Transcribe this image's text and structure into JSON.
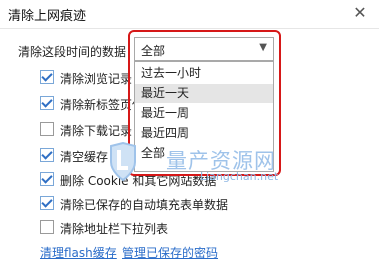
{
  "window": {
    "title": "清除上网痕迹",
    "close_glyph": "✕"
  },
  "range": {
    "label": "清除这段时间的数据：",
    "selected": "全部",
    "arrow_glyph": "▼",
    "options": [
      "过去一小时",
      "最近一天",
      "最近一周",
      "最近四周",
      "全部"
    ],
    "highlighted_index": 1
  },
  "items": [
    {
      "label": "清除浏览记录",
      "checked": true
    },
    {
      "label": "清除新标签页使",
      "checked": true
    },
    {
      "label": "清除下载记录",
      "checked": false
    },
    {
      "label": "清空缓存",
      "checked": true
    },
    {
      "label": "删除 Cookie 和其它网站数据",
      "checked": true
    },
    {
      "label": "清除已保存的自动填充表单数据",
      "checked": true
    },
    {
      "label": "清除地址栏下拉列表",
      "checked": false
    }
  ],
  "links": {
    "flash": "清理flash缓存",
    "passwords": "管理已保存的密码"
  },
  "watermark": {
    "text": "量产资源网",
    "url": "Liangchan.net"
  },
  "colors": {
    "highlight_box": "#d61818",
    "link": "#2a6cc9",
    "check": "#2f6fc4"
  }
}
